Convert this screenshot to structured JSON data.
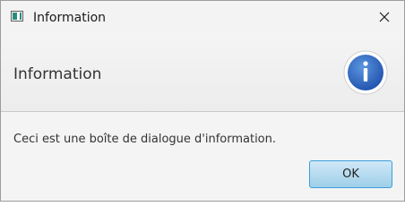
{
  "window": {
    "title": "Information",
    "app_icon": "java-app-icon",
    "close_icon": "close-icon"
  },
  "header": {
    "text": "Information",
    "icon": "info-icon"
  },
  "content": {
    "message": "Ceci est une boîte de dialogue d'information."
  },
  "buttons": {
    "ok_label": "OK"
  },
  "colors": {
    "info_icon_blue": "#2f6fc8",
    "ok_border": "#3c9edc"
  }
}
